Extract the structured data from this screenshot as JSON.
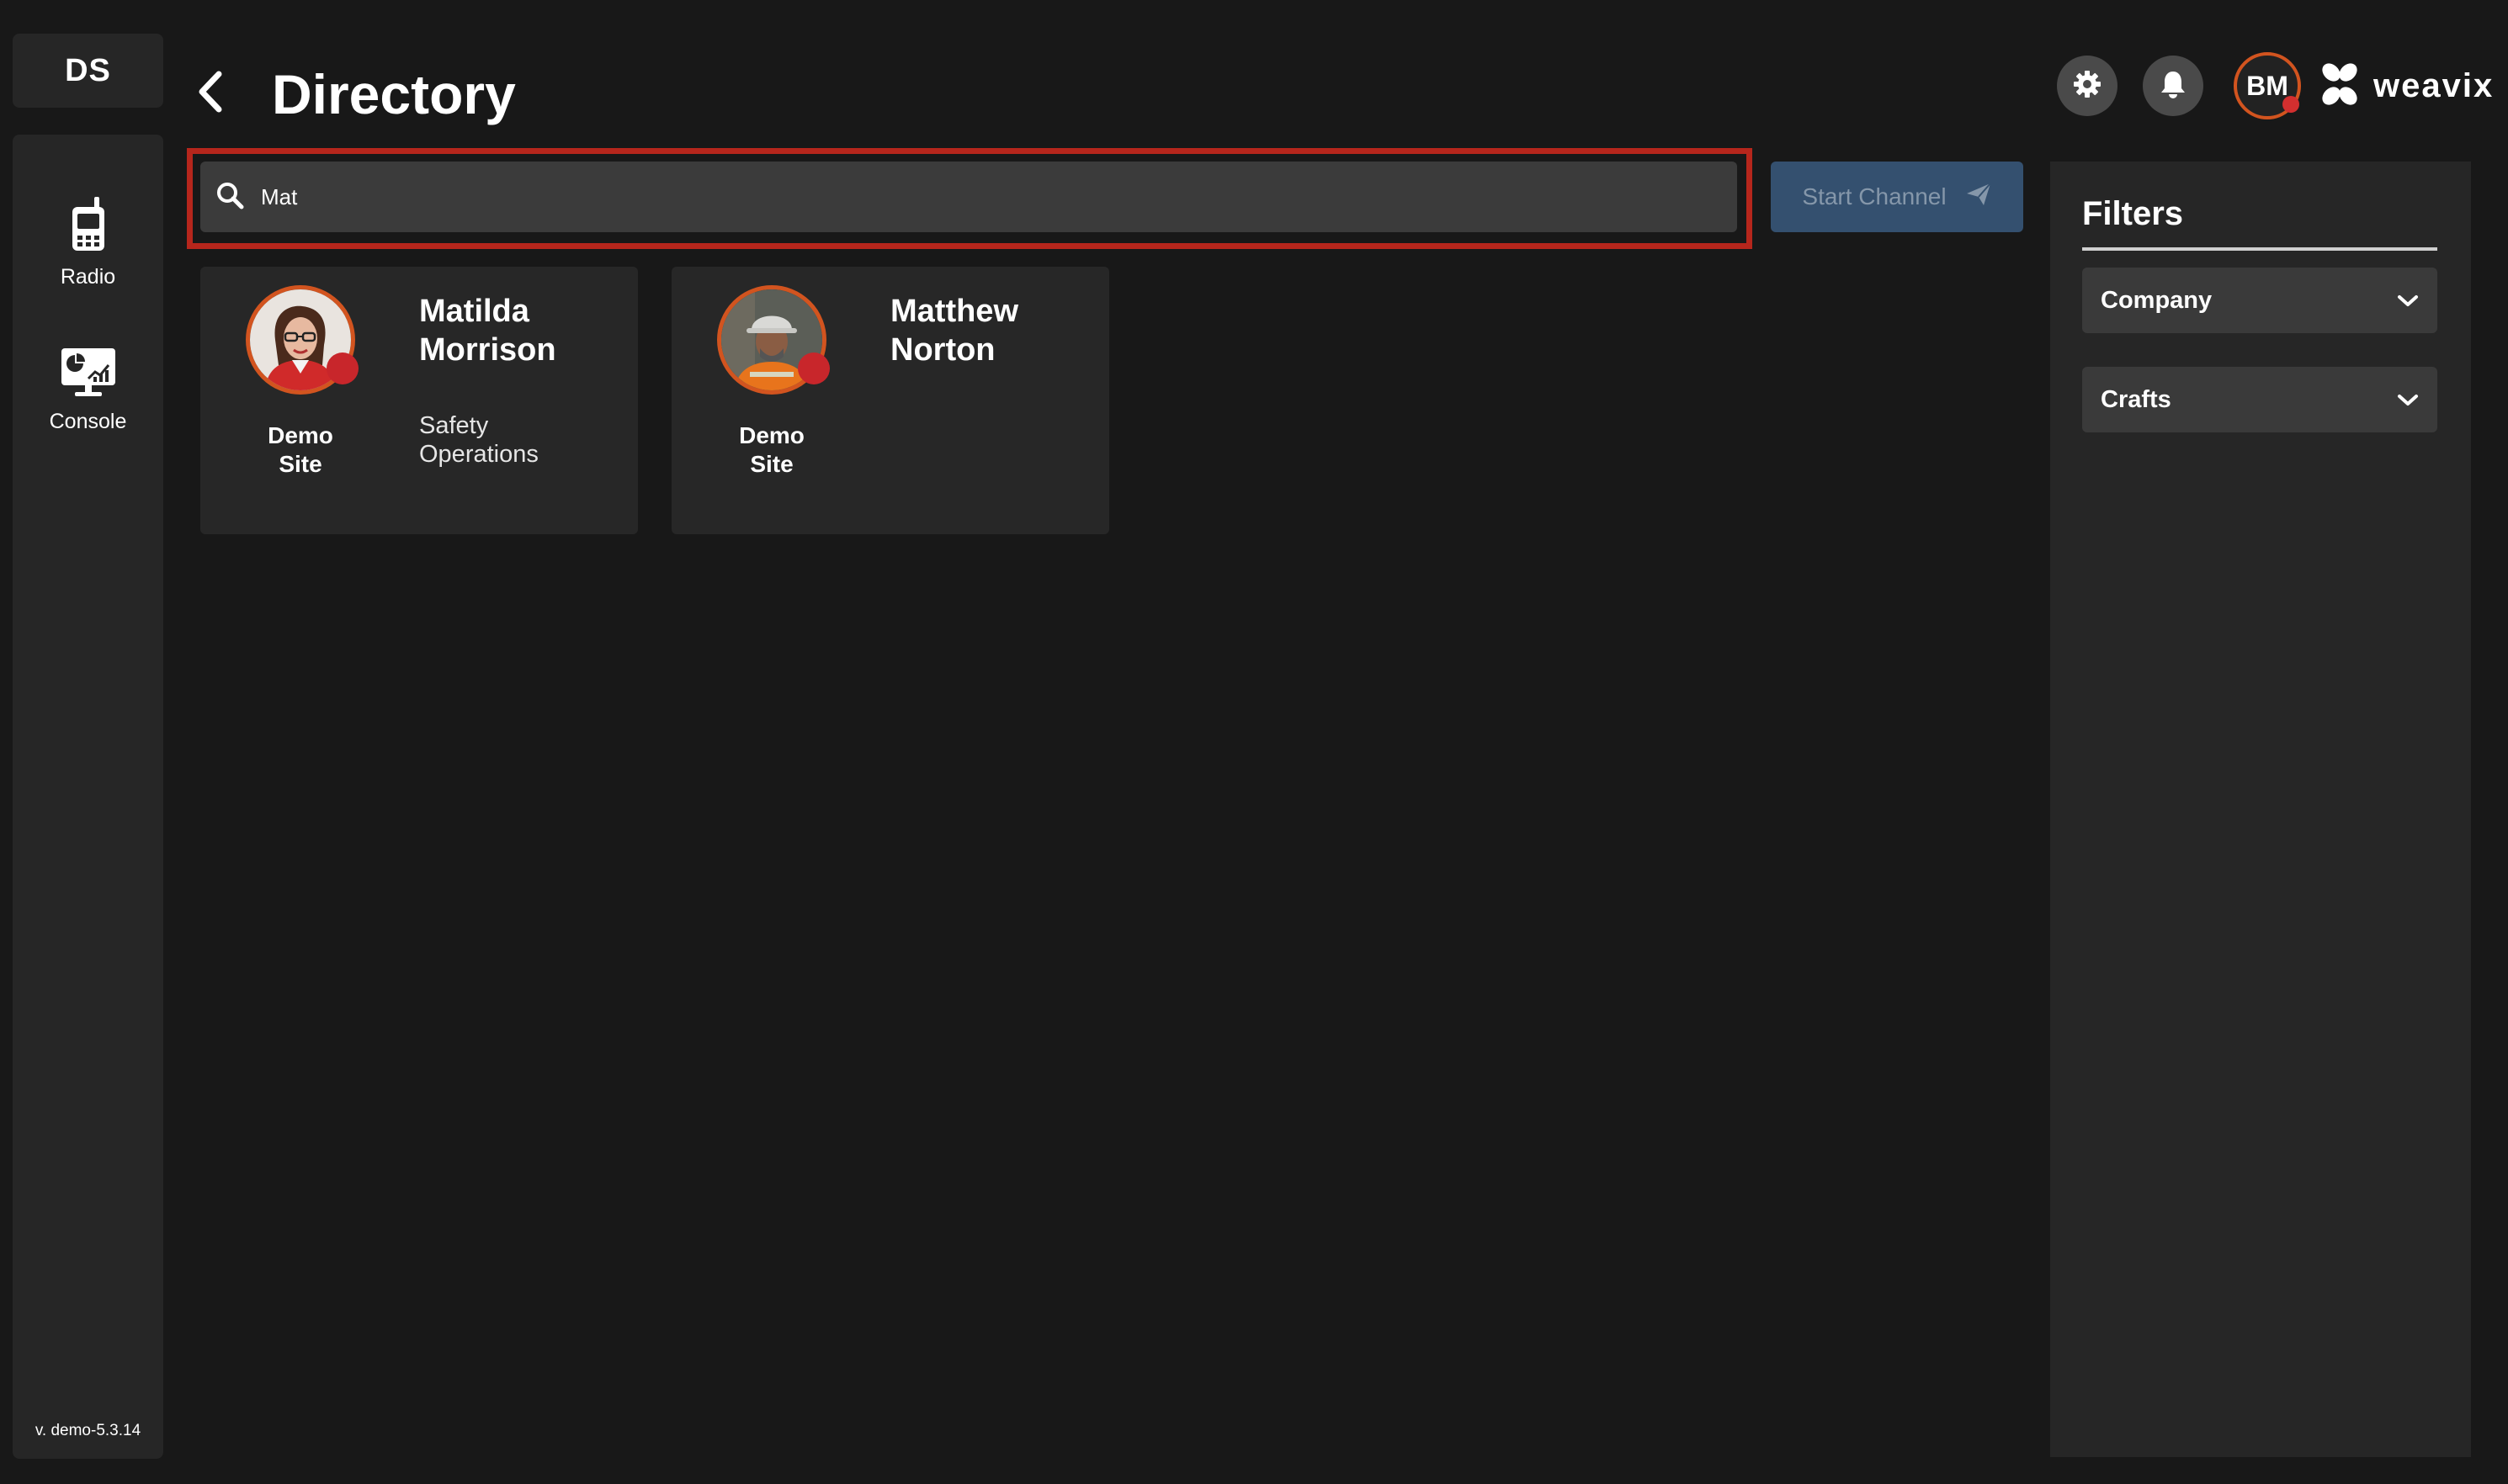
{
  "workspace": {
    "label": "DS"
  },
  "rail": {
    "items": [
      {
        "label": "Radio",
        "icon": "radio-icon"
      },
      {
        "label": "Console",
        "icon": "console-icon"
      }
    ],
    "version": "v. demo-5.3.14"
  },
  "header": {
    "title": "Directory",
    "user_initials": "BM",
    "brand": "weavix"
  },
  "search": {
    "value": "Mat",
    "placeholder": ""
  },
  "start_channel": {
    "label": "Start Channel"
  },
  "people": [
    {
      "first": "Matilda",
      "last": "Morrison",
      "site_line1": "Demo",
      "site_line2": "Site",
      "role_line1": "Safety",
      "role_line2": "Operations"
    },
    {
      "first": "Matthew",
      "last": "Norton",
      "site_line1": "Demo",
      "site_line2": "Site",
      "role_line1": "",
      "role_line2": ""
    }
  ],
  "filters": {
    "title": "Filters",
    "company_label": "Company",
    "crafts_label": "Crafts"
  },
  "colors": {
    "accent_orange": "#d2541f",
    "status_red": "#c8262b",
    "highlight_red": "#b6261c",
    "button_blue": "#34506f"
  }
}
